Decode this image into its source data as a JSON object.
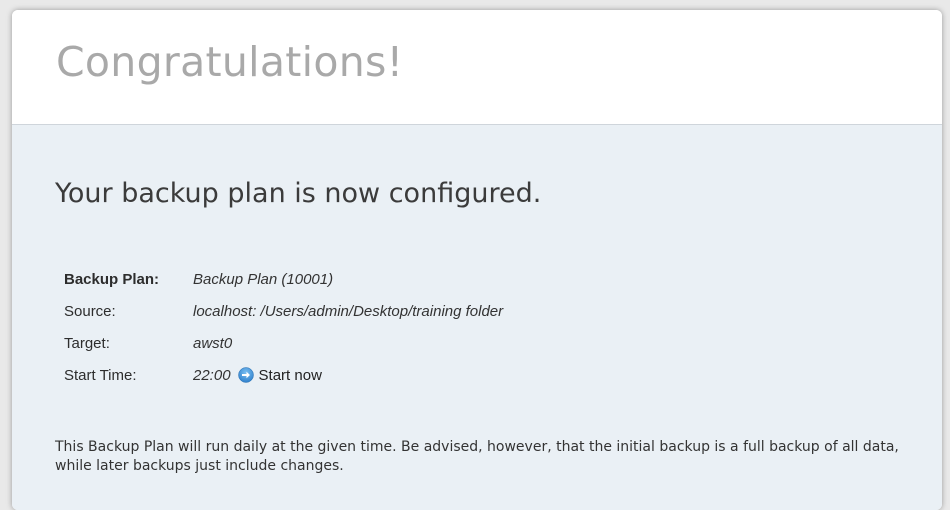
{
  "header": {
    "title": "Congratulations!"
  },
  "main": {
    "subtitle": "Your backup plan is now configured.",
    "details": [
      {
        "label": "Backup Plan:",
        "value": "Backup Plan (10001)"
      },
      {
        "label": "Source:",
        "value": "localhost: /Users/admin/Desktop/training folder"
      },
      {
        "label": "Target:",
        "value": "awst0"
      },
      {
        "label": "Start Time:",
        "value": "22:00"
      }
    ],
    "start_now_label": "Start now",
    "start_now_icon": "arrow-circle-right-icon",
    "note": "This Backup Plan will run daily at the given time. Be advised, however, that the initial backup is a full backup of all data, while later backups just include changes."
  },
  "colors": {
    "title": "#a9a9a9",
    "content_background": "#eaf0f5",
    "icon_blue": "#3a8fd6"
  }
}
